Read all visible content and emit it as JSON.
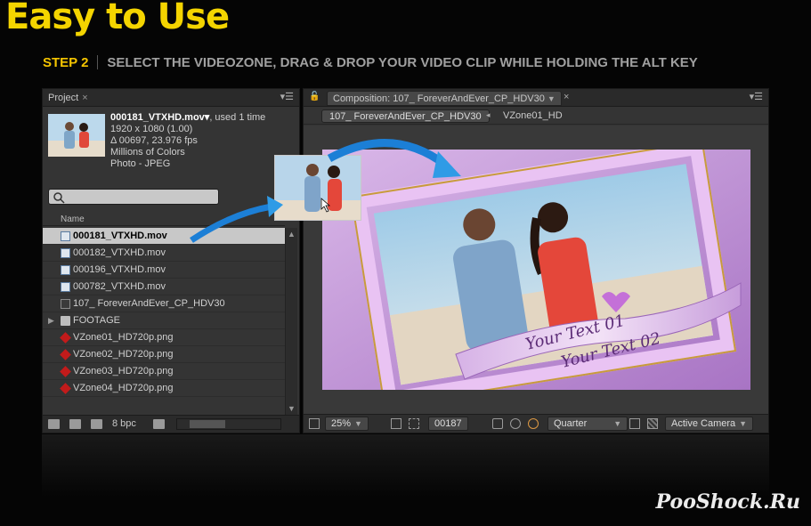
{
  "heading": "Easy to Use",
  "step": {
    "label": "STEP 2",
    "text": "SELECT THE VIDEOZONE, DRAG & DROP YOUR VIDEO CLIP WHILE HOLDING THE ALT KEY"
  },
  "project": {
    "tab": "Project",
    "close": "×",
    "file_name": "000181_VTXHD.mov▾",
    "used": ", used 1 time",
    "meta": [
      "1920 x 1080 (1.00)",
      "Δ 00697, 23.976 fps",
      "Millions of Colors",
      "Photo - JPEG"
    ],
    "col_name": "Name",
    "items": [
      {
        "name": "000181_VTXHD.mov",
        "type": "mov",
        "selected": true
      },
      {
        "name": "000182_VTXHD.mov",
        "type": "mov"
      },
      {
        "name": "000196_VTXHD.mov",
        "type": "mov"
      },
      {
        "name": "000782_VTXHD.mov",
        "type": "mov"
      },
      {
        "name": "107_ ForeverAndEver_CP_HDV30",
        "type": "comp"
      },
      {
        "name": "FOOTAGE",
        "type": "folder"
      },
      {
        "name": "VZone01_HD720p.png",
        "type": "png"
      },
      {
        "name": "VZone02_HD720p.png",
        "type": "png"
      },
      {
        "name": "VZone03_HD720p.png",
        "type": "png"
      },
      {
        "name": "VZone04_HD720p.png",
        "type": "png"
      }
    ],
    "bpc": "8 bpc"
  },
  "composition": {
    "tab": "Composition: 107_ ForeverAndEver_CP_HDV30",
    "close": "×",
    "subtab_active": "107_ ForeverAndEver_CP_HDV30",
    "subtab_other": "VZone01_HD",
    "zoom": "25%",
    "frame": "00187",
    "resolution": "Quarter",
    "camera": "Active Camera",
    "ribbon_text_1": "Your Text 01",
    "ribbon_text_2": "Your Text 02"
  },
  "watermark": "PooShock.Ru",
  "colors": {
    "accent": "#f4d400",
    "frame_purple": "#c9a7dc",
    "arrow_blue": "#2f9be6"
  }
}
